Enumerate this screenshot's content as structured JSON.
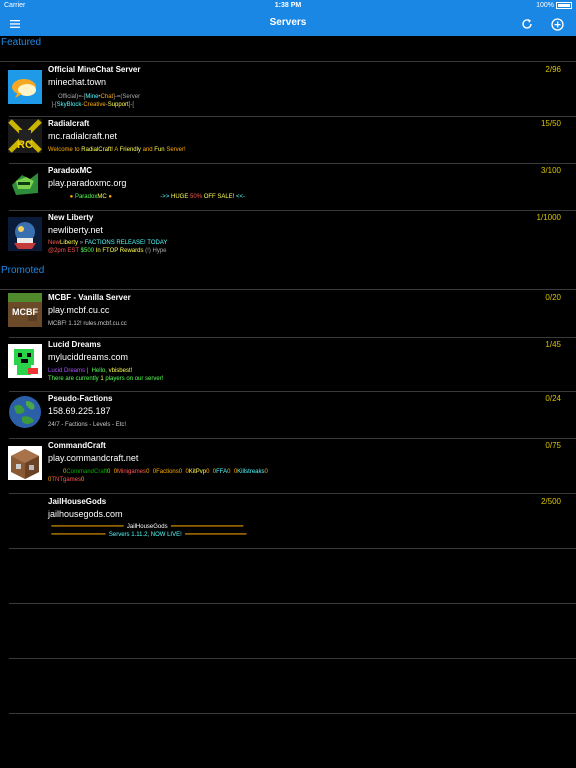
{
  "status_bar": {
    "carrier": "Carrier",
    "time": "1:38 PM",
    "battery": "100%"
  },
  "nav": {
    "title": "Servers"
  },
  "sections": {
    "featured": "Featured",
    "promoted": "Promoted"
  },
  "servers": [
    {
      "name": "Official MineChat Server",
      "count": "2/96",
      "address": "minechat.town",
      "motd": [
        [
          {
            "t": "      Official",
            "c": "#aaaaaa"
          },
          {
            "t": ")=-[",
            "c": "#aaaaaa"
          },
          {
            "t": "Mine",
            "c": "#55ffff"
          },
          {
            "t": "•",
            "c": "#aaaaaa"
          },
          {
            "t": "Chat",
            "c": "#ffaa00"
          },
          {
            "t": "]-=(",
            "c": "#aaaaaa"
          },
          {
            "t": "Server",
            "c": "#aaaaaa"
          }
        ],
        [
          {
            "t": "  ]-[",
            "c": "#aaaaaa"
          },
          {
            "t": "SkyBlock",
            "c": "#55ffff"
          },
          {
            "t": "-",
            "c": "#aaaaaa"
          },
          {
            "t": "Creative",
            "c": "#ffaa00"
          },
          {
            "t": "-",
            "c": "#aaaaaa"
          },
          {
            "t": "Support",
            "c": "#ffff55"
          },
          {
            "t": "]-[",
            "c": "#aaaaaa"
          }
        ]
      ]
    },
    {
      "name": "Radialcraft",
      "count": "15/50",
      "address": "mc.radialcraft.net",
      "motd": [
        [
          {
            "t": "Welcome to ",
            "c": "#ffaa00"
          },
          {
            "t": "RadialCraft! ",
            "c": "#ffff55"
          },
          {
            "t": "A ",
            "c": "#ffaa00"
          },
          {
            "t": "Friendly ",
            "c": "#ffff55"
          },
          {
            "t": "and ",
            "c": "#ffaa00"
          },
          {
            "t": "Fun ",
            "c": "#ffff55"
          },
          {
            "t": "Server!",
            "c": "#ffaa00"
          }
        ]
      ]
    },
    {
      "name": "ParadoxMC",
      "count": "3/100",
      "address": "play.paradoxmc.org",
      "motd": [
        [
          {
            "t": "             ● ",
            "c": "#ffaa00"
          },
          {
            "t": "Paradox",
            "c": "#55ff55"
          },
          {
            "t": "MC",
            "c": "#ffff55"
          },
          {
            "t": " ●                             ",
            "c": "#ffaa00"
          },
          {
            "t": "->> ",
            "c": "#55ffff"
          },
          {
            "t": "HUGE ",
            "c": "#ffff55"
          },
          {
            "t": "50% ",
            "c": "#ff5555"
          },
          {
            "t": "OFF SALE! ",
            "c": "#ffff55"
          },
          {
            "t": "<<-",
            "c": "#55ffff"
          }
        ]
      ]
    },
    {
      "name": "New Liberty",
      "count": "1/1000",
      "address": "newliberty.net",
      "motd": [
        [
          {
            "t": "New",
            "c": "#ff5555"
          },
          {
            "t": "Liberty",
            "c": "#ffff55"
          },
          {
            "t": " » ",
            "c": "#aaaaaa"
          },
          {
            "t": "FACTIONS RELEASE! TODAY",
            "c": "#55ffff"
          }
        ],
        [
          {
            "t": "@2pm EST ",
            "c": "#ff5555"
          },
          {
            "t": "$500 ",
            "c": "#55ff55"
          },
          {
            "t": "In FTOP Rewards ",
            "c": "#ffff55"
          },
          {
            "t": "(!) Hype",
            "c": "#aaaaaa"
          }
        ]
      ]
    },
    {
      "name": "MCBF - Vanilla Server",
      "count": "0/20",
      "address": "play.mcbf.cu.cc",
      "motd": [
        [
          {
            "t": "MCBF! 1.12! rules.mcbf.cu.cc",
            "c": "#cccccc"
          }
        ]
      ]
    },
    {
      "name": "Lucid Dreams",
      "count": "1/45",
      "address": "myluciddreams.com",
      "motd": [
        [
          {
            "t": "Lucid Dreams",
            "c": "#aa55ff"
          },
          {
            "t": " | ",
            "c": "#aaaaaa"
          },
          {
            "t": " Hello, ",
            "c": "#55ff55"
          },
          {
            "t": "vbisbest!",
            "c": "#ffff55"
          }
        ],
        [
          {
            "t": "There are currently ",
            "c": "#55ff55"
          },
          {
            "t": "1",
            "c": "#ffff55"
          },
          {
            "t": " players on our server!",
            "c": "#55ff55"
          }
        ]
      ]
    },
    {
      "name": "Pseudo-Factions",
      "count": "0/24",
      "address": "158.69.225.187",
      "motd": [
        [
          {
            "t": "24/7 - Factions - Levels - Etc!",
            "c": "#cccccc"
          }
        ]
      ]
    },
    {
      "name": "CommandCraft",
      "count": "0/75",
      "address": "play.commandcraft.net",
      "motd": [
        [
          {
            "t": "         0",
            "c": "#ffaa00"
          },
          {
            "t": "CommandCraft",
            "c": "#00aa00"
          },
          {
            "t": "0  ",
            "c": "#ffaa00"
          },
          {
            "t": "0",
            "c": "#ffaa00"
          },
          {
            "t": "Minigames",
            "c": "#ff5555"
          },
          {
            "t": "0  ",
            "c": "#ffaa00"
          },
          {
            "t": "0",
            "c": "#ffaa00"
          },
          {
            "t": "Factions",
            "c": "#ffaa00"
          },
          {
            "t": "0  ",
            "c": "#ffaa00"
          },
          {
            "t": "0",
            "c": "#ffaa00"
          },
          {
            "t": "KitPvp",
            "c": "#ffff55"
          },
          {
            "t": "0  ",
            "c": "#ffaa00"
          },
          {
            "t": "0",
            "c": "#ffaa00"
          },
          {
            "t": "FFA",
            "c": "#55ffff"
          },
          {
            "t": "0  ",
            "c": "#ffaa00"
          },
          {
            "t": "0",
            "c": "#ffaa00"
          },
          {
            "t": "Killstreaks",
            "c": "#55ffff"
          },
          {
            "t": "0",
            "c": "#ffaa00"
          }
        ],
        [
          {
            "t": "0",
            "c": "#ffaa00"
          },
          {
            "t": "TNTgames",
            "c": "#ff5555"
          },
          {
            "t": "0",
            "c": "#ffaa00"
          }
        ]
      ]
    },
    {
      "name": "JailHouseGods",
      "count": "2/500",
      "address": "jailhousegods.com",
      "motd": [
        [
          {
            "t": "  ━━━━━━━━━━━━━━━━━━━━  ",
            "c": "#ffaa00"
          },
          {
            "t": "JailHouseGods",
            "c": "#ffffff"
          },
          {
            "t": "  ━━━━━━━━━━━━━━━━━━━━",
            "c": "#ffaa00"
          }
        ],
        [
          {
            "t": "  ━━━━━━━━━━━━━━━  ",
            "c": "#ffaa00"
          },
          {
            "t": "Servers 1.11.2, NOW LIVE!",
            "c": "#55ffff"
          },
          {
            "t": "  ━━━━━━━━━━━━━━━━━",
            "c": "#ffaa00"
          }
        ]
      ]
    }
  ]
}
